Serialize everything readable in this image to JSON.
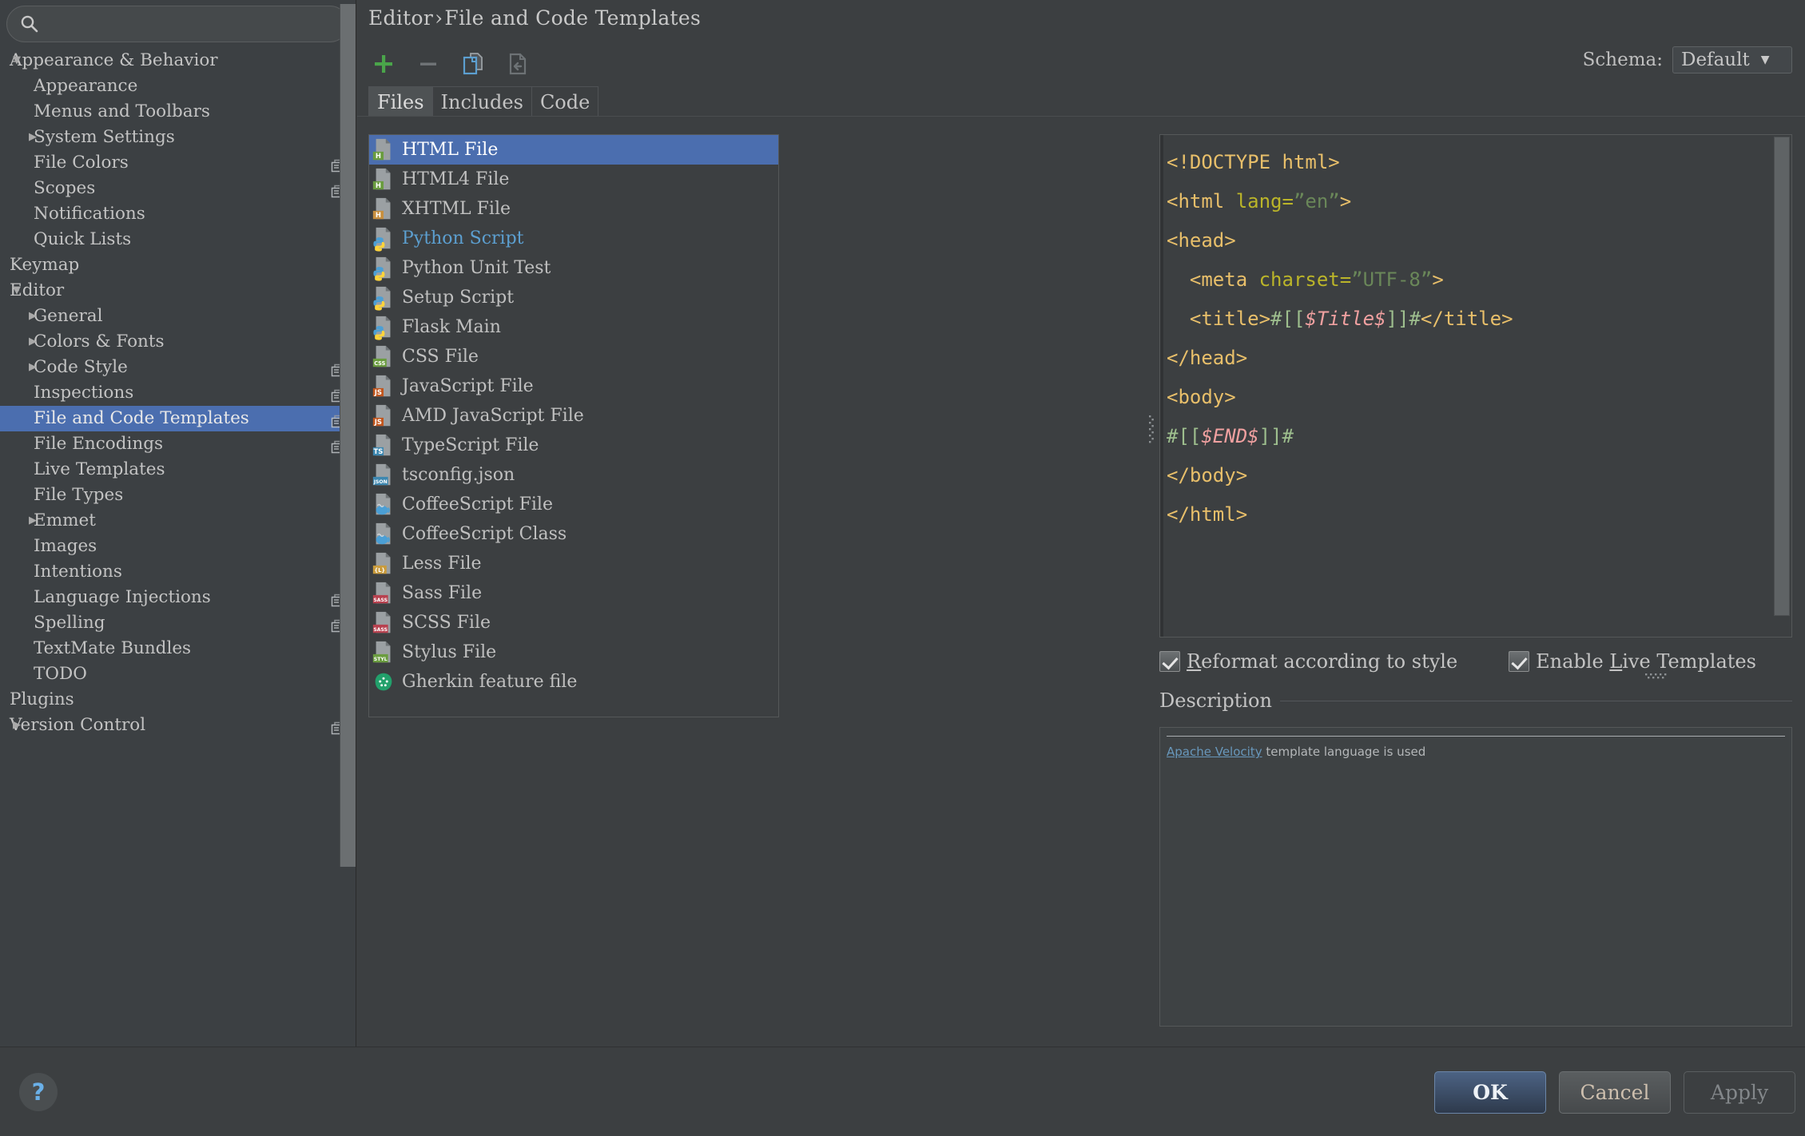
{
  "search": {
    "placeholder": "",
    "value": "",
    "icon": "search-icon"
  },
  "sidebar": {
    "items": [
      {
        "label": "Appearance & Behavior",
        "level": 0,
        "arrow": "down",
        "copy": false,
        "selected": false
      },
      {
        "label": "Appearance",
        "level": 1,
        "arrow": "none",
        "copy": false,
        "selected": false
      },
      {
        "label": "Menus and Toolbars",
        "level": 1,
        "arrow": "none",
        "copy": false,
        "selected": false
      },
      {
        "label": "System Settings",
        "level": 1,
        "arrow": "right",
        "copy": false,
        "selected": false
      },
      {
        "label": "File Colors",
        "level": 1,
        "arrow": "none",
        "copy": true,
        "selected": false
      },
      {
        "label": "Scopes",
        "level": 1,
        "arrow": "none",
        "copy": true,
        "selected": false
      },
      {
        "label": "Notifications",
        "level": 1,
        "arrow": "none",
        "copy": false,
        "selected": false
      },
      {
        "label": "Quick Lists",
        "level": 1,
        "arrow": "none",
        "copy": false,
        "selected": false
      },
      {
        "label": "Keymap",
        "level": 0,
        "arrow": "none",
        "copy": false,
        "selected": false
      },
      {
        "label": "Editor",
        "level": 0,
        "arrow": "down",
        "copy": false,
        "selected": false
      },
      {
        "label": "General",
        "level": 1,
        "arrow": "right",
        "copy": false,
        "selected": false
      },
      {
        "label": "Colors & Fonts",
        "level": 1,
        "arrow": "right",
        "copy": false,
        "selected": false
      },
      {
        "label": "Code Style",
        "level": 1,
        "arrow": "right",
        "copy": true,
        "selected": false
      },
      {
        "label": "Inspections",
        "level": 1,
        "arrow": "none",
        "copy": true,
        "selected": false
      },
      {
        "label": "File and Code Templates",
        "level": 1,
        "arrow": "none",
        "copy": true,
        "selected": true
      },
      {
        "label": "File Encodings",
        "level": 1,
        "arrow": "none",
        "copy": true,
        "selected": false
      },
      {
        "label": "Live Templates",
        "level": 1,
        "arrow": "none",
        "copy": false,
        "selected": false
      },
      {
        "label": "File Types",
        "level": 1,
        "arrow": "none",
        "copy": false,
        "selected": false
      },
      {
        "label": "Emmet",
        "level": 1,
        "arrow": "right",
        "copy": false,
        "selected": false
      },
      {
        "label": "Images",
        "level": 1,
        "arrow": "none",
        "copy": false,
        "selected": false
      },
      {
        "label": "Intentions",
        "level": 1,
        "arrow": "none",
        "copy": false,
        "selected": false
      },
      {
        "label": "Language Injections",
        "level": 1,
        "arrow": "none",
        "copy": true,
        "selected": false
      },
      {
        "label": "Spelling",
        "level": 1,
        "arrow": "none",
        "copy": true,
        "selected": false
      },
      {
        "label": "TextMate Bundles",
        "level": 1,
        "arrow": "none",
        "copy": false,
        "selected": false
      },
      {
        "label": "TODO",
        "level": 1,
        "arrow": "none",
        "copy": false,
        "selected": false
      },
      {
        "label": "Plugins",
        "level": 0,
        "arrow": "none",
        "copy": false,
        "selected": false
      },
      {
        "label": "Version Control",
        "level": 0,
        "arrow": "right",
        "copy": true,
        "selected": false
      }
    ]
  },
  "breadcrumb": {
    "root": "Editor",
    "separator": "›",
    "leaf": "File and Code Templates"
  },
  "toolbar": {
    "add_label": "+",
    "remove_label": "−",
    "copy_name": "copy-template-icon",
    "reset_name": "reset-to-default-icon"
  },
  "schema": {
    "label": "Schema:",
    "value": "Default",
    "caret": "▼"
  },
  "tabs": [
    {
      "label": "Files",
      "active": true
    },
    {
      "label": "Includes",
      "active": false
    },
    {
      "label": "Code",
      "active": false
    }
  ],
  "templates": [
    {
      "label": "HTML File",
      "icon": "html-file-icon",
      "badge": "H",
      "badge_color": "#6a9c3f",
      "selected": true,
      "modified": false
    },
    {
      "label": "HTML4 File",
      "icon": "html-file-icon",
      "badge": "H",
      "badge_color": "#6a9c3f",
      "selected": false,
      "modified": false
    },
    {
      "label": "XHTML File",
      "icon": "xhtml-file-icon",
      "badge": "H",
      "badge_color": "#c78f3f",
      "selected": false,
      "modified": false
    },
    {
      "label": "Python Script",
      "icon": "python-file-icon",
      "badge": "",
      "badge_color": "",
      "selected": false,
      "modified": true
    },
    {
      "label": "Python Unit Test",
      "icon": "python-file-icon",
      "badge": "",
      "badge_color": "",
      "selected": false,
      "modified": false
    },
    {
      "label": "Setup Script",
      "icon": "python-file-icon",
      "badge": "",
      "badge_color": "",
      "selected": false,
      "modified": false
    },
    {
      "label": "Flask Main",
      "icon": "python-file-icon",
      "badge": "",
      "badge_color": "",
      "selected": false,
      "modified": false
    },
    {
      "label": "CSS File",
      "icon": "css-file-icon",
      "badge": "CSS",
      "badge_color": "#6a9c3f",
      "selected": false,
      "modified": false
    },
    {
      "label": "JavaScript File",
      "icon": "js-file-icon",
      "badge": "JS",
      "badge_color": "#c1561e",
      "selected": false,
      "modified": false
    },
    {
      "label": "AMD JavaScript File",
      "icon": "js-file-icon",
      "badge": "JS",
      "badge_color": "#c1561e",
      "selected": false,
      "modified": false
    },
    {
      "label": "TypeScript File",
      "icon": "ts-file-icon",
      "badge": "TS",
      "badge_color": "#3d87b0",
      "selected": false,
      "modified": false
    },
    {
      "label": "tsconfig.json",
      "icon": "json-file-icon",
      "badge": "JSON",
      "badge_color": "#3d87b0",
      "selected": false,
      "modified": false
    },
    {
      "label": "CoffeeScript File",
      "icon": "coffeescript-file-icon",
      "badge": "",
      "badge_color": "",
      "selected": false,
      "modified": false
    },
    {
      "label": "CoffeeScript Class",
      "icon": "coffeescript-file-icon",
      "badge": "",
      "badge_color": "",
      "selected": false,
      "modified": false
    },
    {
      "label": "Less File",
      "icon": "less-file-icon",
      "badge": "{L}",
      "badge_color": "#c99b3c",
      "selected": false,
      "modified": false
    },
    {
      "label": "Sass File",
      "icon": "sass-file-icon",
      "badge": "SASS",
      "badge_color": "#b8414f",
      "selected": false,
      "modified": false
    },
    {
      "label": "SCSS File",
      "icon": "sass-file-icon",
      "badge": "SASS",
      "badge_color": "#b8414f",
      "selected": false,
      "modified": false
    },
    {
      "label": "Stylus File",
      "icon": "stylus-file-icon",
      "badge": "STYL",
      "badge_color": "#6a9c3f",
      "selected": false,
      "modified": false
    },
    {
      "label": "Gherkin feature file",
      "icon": "gherkin-file-icon",
      "badge": "",
      "badge_color": "",
      "selected": false,
      "modified": false
    }
  ],
  "editor": {
    "lines": [
      [
        {
          "t": "<!DOCTYPE html>",
          "c": "t-tag"
        }
      ],
      [
        {
          "t": "<html ",
          "c": "t-tag"
        },
        {
          "t": "lang=",
          "c": "t-attr"
        },
        {
          "t": "”en”",
          "c": "t-str"
        },
        {
          "t": ">",
          "c": "t-tag"
        }
      ],
      [
        {
          "t": "<head>",
          "c": "t-tag"
        }
      ],
      [
        {
          "t": "  <meta ",
          "c": "t-tag"
        },
        {
          "t": "charset=",
          "c": "t-attr"
        },
        {
          "t": "”UTF-8”",
          "c": "t-str"
        },
        {
          "t": ">",
          "c": "t-tag"
        }
      ],
      [
        {
          "t": "  <title>",
          "c": "t-tag"
        },
        {
          "t": "#[[",
          "c": "t-brace"
        },
        {
          "t": "$Title$",
          "c": "t-var"
        },
        {
          "t": "]]#",
          "c": "t-brace"
        },
        {
          "t": "</title>",
          "c": "t-tag"
        }
      ],
      [
        {
          "t": "</head>",
          "c": "t-tag"
        }
      ],
      [
        {
          "t": "<body>",
          "c": "t-tag"
        }
      ],
      [
        {
          "t": "#[[",
          "c": "t-brace"
        },
        {
          "t": "$END$",
          "c": "t-var"
        },
        {
          "t": "]]#",
          "c": "t-brace"
        }
      ],
      [
        {
          "t": "</body>",
          "c": "t-tag"
        }
      ],
      [
        {
          "t": "</html>",
          "c": "t-tag"
        }
      ]
    ]
  },
  "options": {
    "reformat": {
      "label_before": "",
      "mnemonic": "R",
      "label_after": "eformat according to style",
      "checked": true
    },
    "live_templates": {
      "label_before": "Enable ",
      "mnemonic": "L",
      "label_after": "ive Templates",
      "checked": true
    }
  },
  "description": {
    "title": "Description",
    "link_text": "Apache Velocity",
    "rest_text": " template language is used"
  },
  "footer": {
    "help_label": "?",
    "ok_label": "OK",
    "cancel_label": "Cancel",
    "apply_label": "Apply"
  },
  "colors": {
    "selection": "#4b6eaf",
    "accent_add": "#4aa54a",
    "link": "#6897bb",
    "bg": "#3c3f41"
  }
}
